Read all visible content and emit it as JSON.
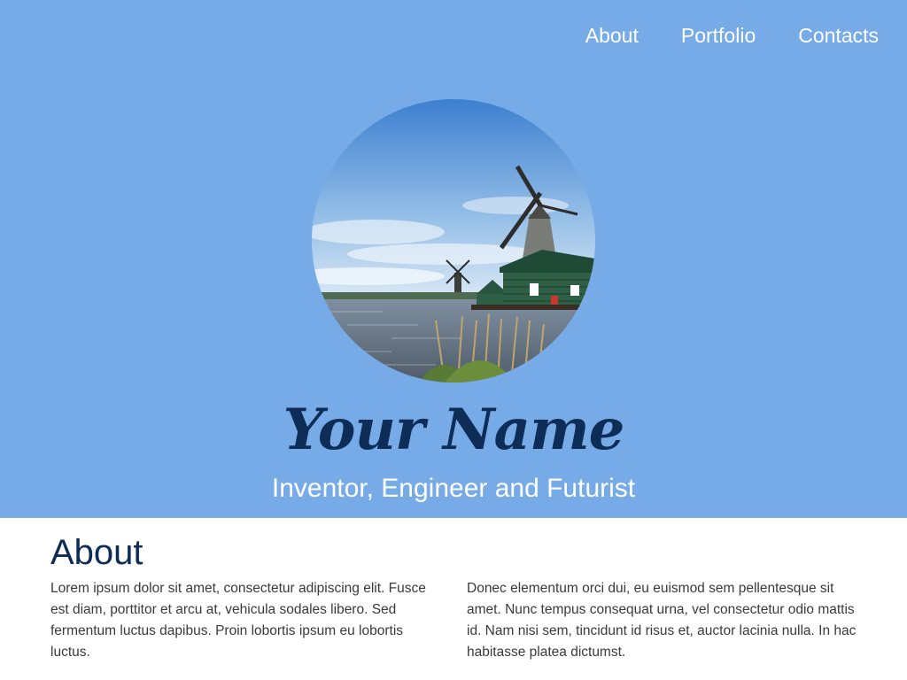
{
  "nav": {
    "items": [
      {
        "label": "About"
      },
      {
        "label": "Portfolio"
      },
      {
        "label": "Contacts"
      }
    ]
  },
  "hero": {
    "name": "Your Name",
    "tagline": "Inventor, Engineer and Futurist",
    "background_color": "#76abe8",
    "name_color": "#0d2d57"
  },
  "about": {
    "heading": "About",
    "paragraph_1": "Lorem ipsum dolor sit amet, consectetur adipiscing elit. Fusce est diam, porttitor et arcu at, vehicula sodales libero. Sed fermentum luctus dapibus. Proin lobortis ipsum eu lobortis luctus.",
    "paragraph_2": "Donec elementum orci dui, eu euismod sem pellentesque sit amet. Nunc tempus consequat urna, vel consectetur odio mattis id. Nam nisi sem, tincidunt id risus et, auctor lacinia nulla. In hac habitasse platea dictumst."
  }
}
